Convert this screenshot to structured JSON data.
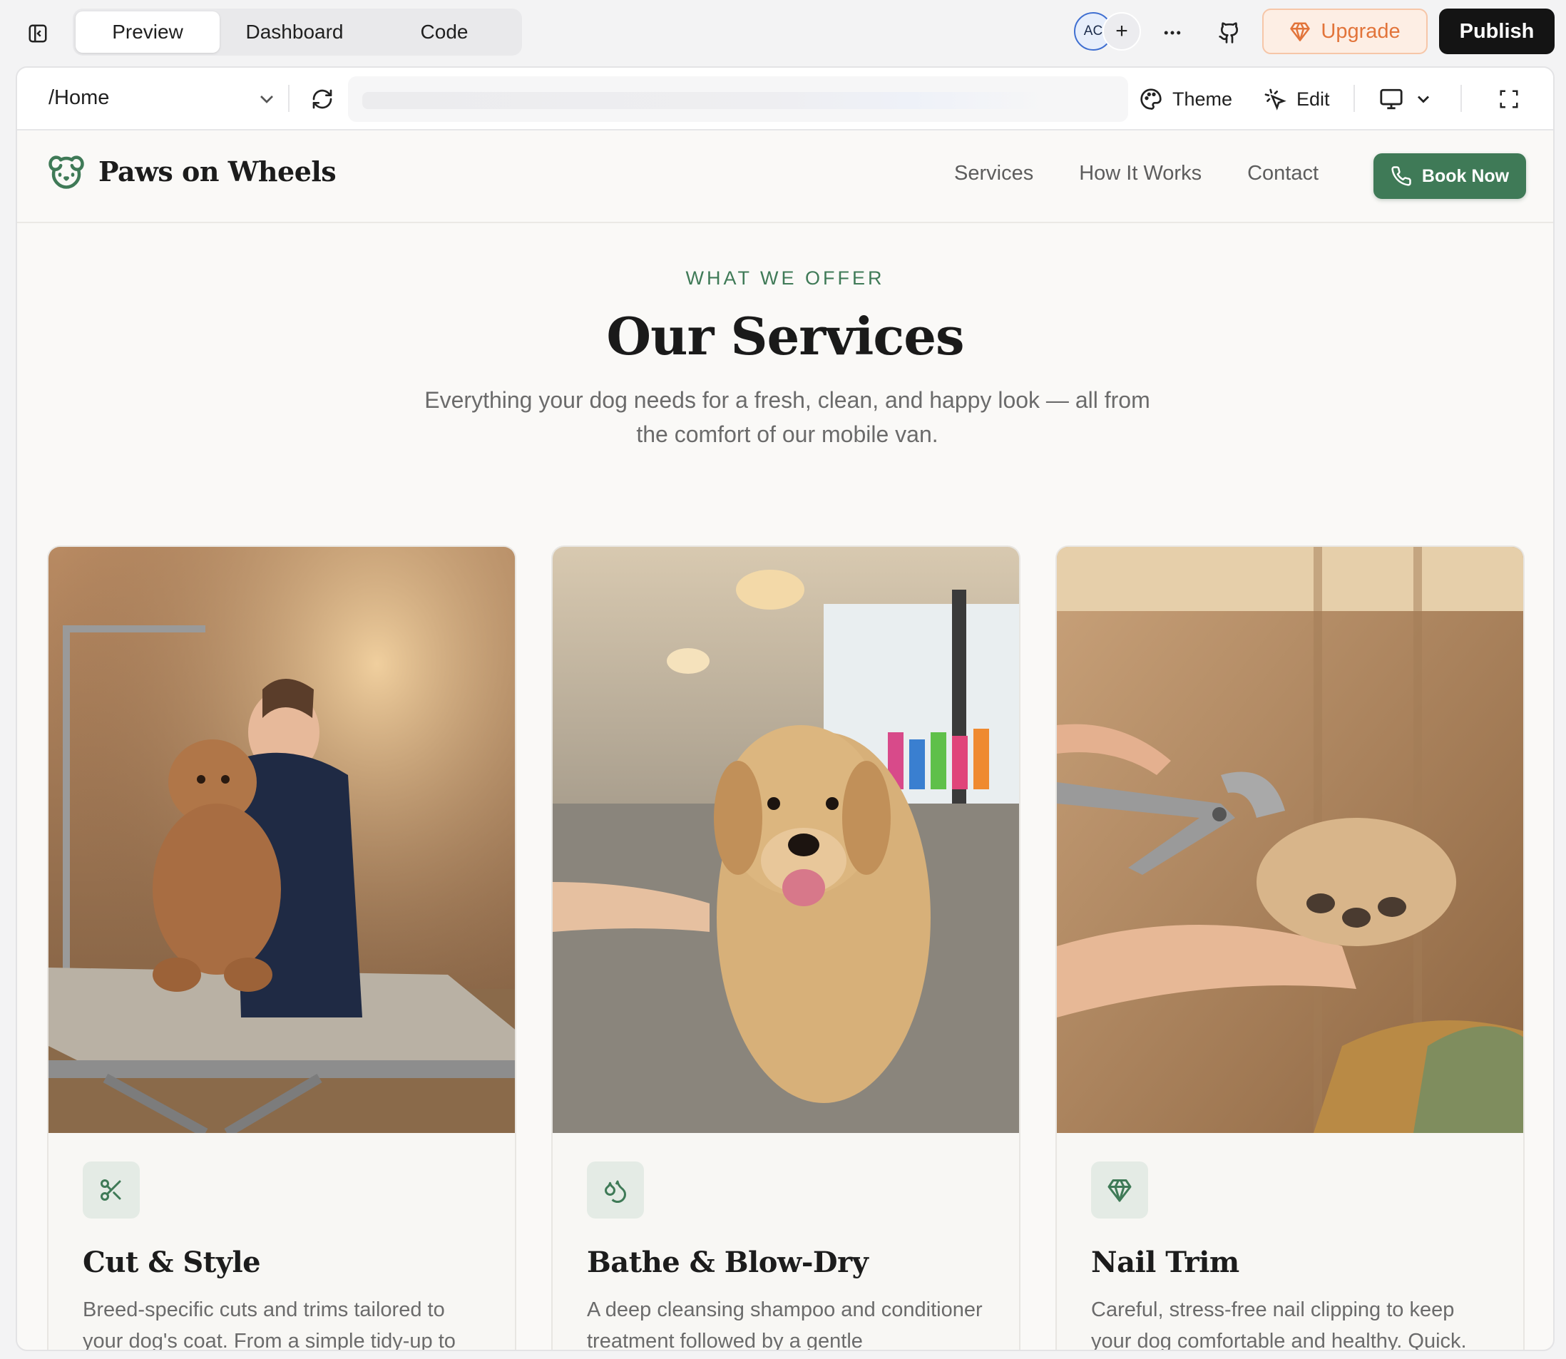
{
  "app_tabs": [
    "Preview",
    "Dashboard",
    "Code"
  ],
  "active_tab": "Preview",
  "avatar_initials": "AC",
  "avatar_add_label": "+",
  "upgrade_label": "Upgrade",
  "publish_label": "Publish",
  "preview_toolbar": {
    "route": "/Home",
    "theme_label": "Theme",
    "edit_label": "Edit"
  },
  "site": {
    "brand": "Paws on Wheels",
    "nav": [
      "Services",
      "How It Works",
      "Contact"
    ],
    "book_label": "Book Now",
    "eyebrow": "WHAT WE OFFER",
    "heading": "Our Services",
    "subheading": "Everything your dog needs for a fresh, clean, and happy look — all from the comfort of our mobile van.",
    "cards": [
      {
        "title": "Cut & Style",
        "description": "Breed-specific cuts and trims tailored to your dog's coat. From a simple tidy-up to",
        "icon": "scissors-icon"
      },
      {
        "title": "Bathe & Blow-Dry",
        "description": "A deep cleansing shampoo and conditioner treatment followed by a gentle",
        "icon": "droplets-icon"
      },
      {
        "title": "Nail Trim",
        "description": "Careful, stress-free nail clipping to keep your dog comfortable and healthy. Quick.",
        "icon": "gem-icon"
      }
    ]
  },
  "colors": {
    "brand_green": "#3f7a57",
    "upgrade_orange": "#e2743a",
    "publish_black": "#141414"
  }
}
